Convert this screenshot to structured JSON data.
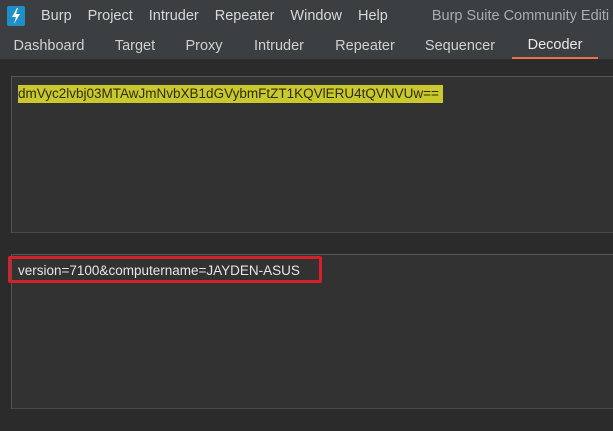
{
  "menubar": {
    "items": [
      "Burp",
      "Project",
      "Intruder",
      "Repeater",
      "Window",
      "Help"
    ],
    "app_title": "Burp Suite Community Editi"
  },
  "tabs": [
    "Dashboard",
    "Target",
    "Proxy",
    "Intruder",
    "Repeater",
    "Sequencer",
    "Decoder"
  ],
  "active_tab": "Decoder",
  "decoder": {
    "input_text": "dmVyc2lvbj03MTAwJmNvbXB1dGVybmFtZT1KQVlERU4tQVNVUw==",
    "output_text": "version=7100&computername=JAYDEN-ASUS"
  },
  "colors": {
    "accent_tab": "#e8734a",
    "input_highlight": "#c9c82d",
    "annotation_red": "#d3202a",
    "logo_blue": "#1e8fc8"
  }
}
